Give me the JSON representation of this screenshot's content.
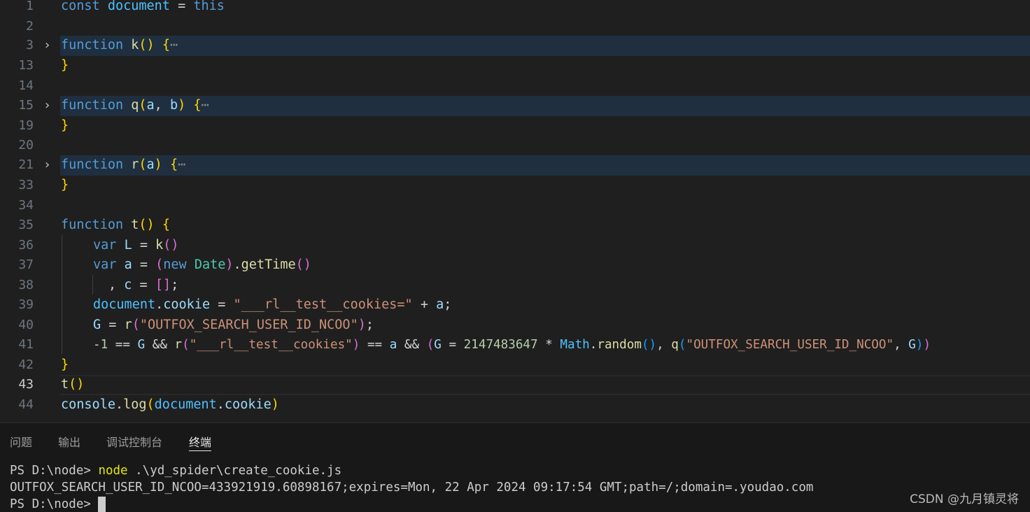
{
  "editor": {
    "lines": [
      {
        "n": "1",
        "text": "const document = this"
      },
      {
        "n": "2",
        "text": ""
      },
      {
        "n": "3",
        "text": "function k() {⋯"
      },
      {
        "n": "13",
        "text": "}"
      },
      {
        "n": "14",
        "text": ""
      },
      {
        "n": "15",
        "text": "function q(a, b) {⋯"
      },
      {
        "n": "19",
        "text": "}"
      },
      {
        "n": "20",
        "text": ""
      },
      {
        "n": "21",
        "text": "function r(a) {⋯"
      },
      {
        "n": "33",
        "text": "}"
      },
      {
        "n": "34",
        "text": ""
      },
      {
        "n": "35",
        "text": "function t() {"
      },
      {
        "n": "36",
        "text": "var L = k()"
      },
      {
        "n": "37",
        "text": "var a = (new Date).getTime()"
      },
      {
        "n": "38",
        "text": ", c = [];"
      },
      {
        "n": "39",
        "text": "document.cookie = \"___rl__test__cookies=\" + a;"
      },
      {
        "n": "40",
        "text": "G = r(\"OUTFOX_SEARCH_USER_ID_NCOO\");"
      },
      {
        "n": "41",
        "text": "-1 == G && r(\"___rl__test__cookies\") == a && (G = 2147483647 * Math.random(), q(\"OUTFOX_SEARCH_USER_ID_NCOO\", G))"
      },
      {
        "n": "42",
        "text": "}"
      },
      {
        "n": "43",
        "text": "t()"
      },
      {
        "n": "44",
        "text": "console.log(document.cookie)"
      }
    ]
  },
  "panel": {
    "tabs": [
      "问题",
      "输出",
      "调试控制台",
      "终端"
    ],
    "active_tab": "终端",
    "terminal": {
      "line1_prompt": "PS D:\\node> ",
      "line1_cmd": "node",
      "line1_args": " .\\yd_spider\\create_cookie.js",
      "line2": "OUTFOX_SEARCH_USER_ID_NCOO=433921919.60898167;expires=Mon, 22 Apr 2024 09:17:54 GMT;path=/;domain=.youdao.com",
      "line3_prompt": "PS D:\\node> "
    }
  },
  "watermark": "CSDN @九月镇灵将"
}
